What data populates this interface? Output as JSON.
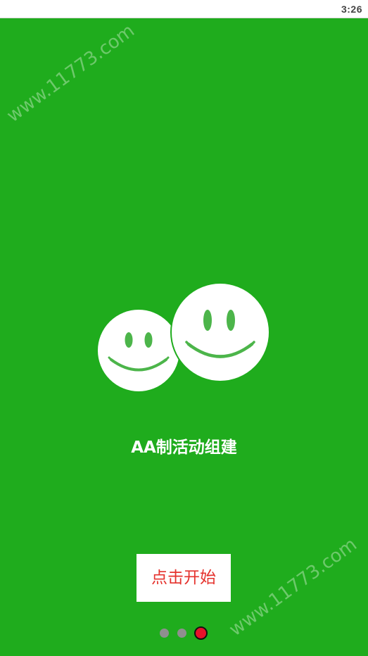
{
  "status_bar": {
    "time": "3:26"
  },
  "watermark": {
    "text": "www.11773.com"
  },
  "logo": {
    "icon": "two-smiley-faces-icon",
    "face_color": "#ffffff",
    "feature_color": "#4cb54a"
  },
  "main": {
    "title": "AA制活动组建",
    "start_button_label": "点击开始"
  },
  "pager": {
    "total": 3,
    "active_index": 3,
    "active_color": "#e8112a",
    "inactive_color": "#8f8f8f"
  },
  "colors": {
    "background": "#1fac1d",
    "start_text": "#e5322d"
  }
}
